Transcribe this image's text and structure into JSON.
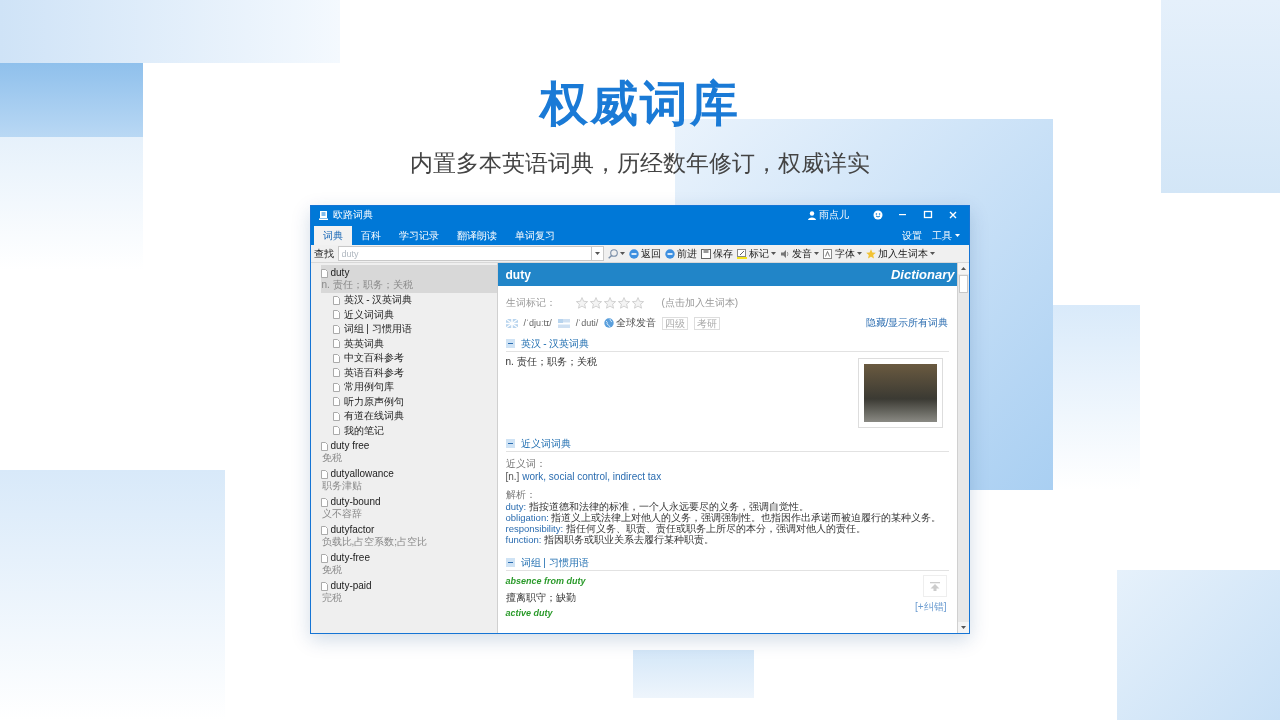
{
  "page": {
    "title": "权威词库",
    "subtitle": "内置多本英语词典，历经数年修订，权威详实"
  },
  "app": {
    "title": "欧路词典",
    "user": "雨点儿",
    "tabs": [
      {
        "label": "词典",
        "selected": true
      },
      {
        "label": "百科",
        "selected": false
      },
      {
        "label": "学习记录",
        "selected": false
      },
      {
        "label": "翻译朗读",
        "selected": false
      },
      {
        "label": "单词复习",
        "selected": false
      }
    ],
    "menu": [
      {
        "label": "设置",
        "dropdown": false
      },
      {
        "label": "工具",
        "dropdown": true
      }
    ],
    "search": {
      "label": "查找",
      "value": "duty"
    },
    "toolbar": [
      {
        "kind": "back",
        "label": "返回",
        "dropdown": false
      },
      {
        "kind": "forward",
        "label": "前进",
        "dropdown": false
      },
      {
        "kind": "save",
        "label": "保存",
        "dropdown": false
      },
      {
        "kind": "mark",
        "label": "标记",
        "dropdown": true
      },
      {
        "kind": "speak",
        "label": "发音",
        "dropdown": true
      },
      {
        "kind": "font",
        "label": "字体",
        "dropdown": true
      },
      {
        "kind": "star",
        "label": "加入生词本",
        "dropdown": true
      }
    ],
    "sidebar": [
      {
        "word": "duty",
        "meaning": "n. 责任；职务；关税",
        "selected": true,
        "children": [
          {
            "label": "英汉 - 汉英词典"
          },
          {
            "label": "近义词词典"
          },
          {
            "label": "词组 | 习惯用语"
          },
          {
            "label": "英英词典"
          },
          {
            "label": "中文百科参考"
          },
          {
            "label": "英语百科参考"
          },
          {
            "label": "常用例句库"
          },
          {
            "label": "听力原声例句"
          },
          {
            "label": "有道在线词典"
          },
          {
            "label": "我的笔记"
          }
        ]
      },
      {
        "word": "duty free",
        "meaning": "免税",
        "selected": false
      },
      {
        "word": "dutyallowance",
        "meaning": "职务津贴",
        "selected": false
      },
      {
        "word": "duty-bound",
        "meaning": "义不容辞",
        "selected": false
      },
      {
        "word": "dutyfactor",
        "meaning": "负载比,占空系数;占空比",
        "selected": false
      },
      {
        "word": "duty-free",
        "meaning": "免税",
        "selected": false
      },
      {
        "word": "duty-paid",
        "meaning": "完税",
        "selected": false
      }
    ],
    "entry": {
      "word": "duty",
      "brand": "Dictionary",
      "stars_label": "生词标记：",
      "stars": 0,
      "stars_hint": "(点击加入生词本)",
      "pron": [
        {
          "kind": "uk",
          "text": "/ˈdjuːtɪ/"
        },
        {
          "kind": "us",
          "text": "/ˈduti/"
        }
      ],
      "global_pron": "全球发音",
      "tags": [
        "四级",
        "考研"
      ],
      "toggle_all": "隐藏/显示所有词典",
      "sections": [
        {
          "kind": "definition",
          "title": "英汉 - 汉英词典",
          "expanded": true,
          "text": "n. 责任；职务；关税"
        },
        {
          "kind": "synonyms",
          "title": "近义词词典",
          "expanded": true,
          "syn_label": "近义词：",
          "pos": "[n.]",
          "words": "work, social control, indirect tax",
          "analysis_label": "解析：",
          "lines": [
            {
              "term": "duty:",
              "text": "指按道德和法律的标准，一个人永远要尽的义务，强调自觉性。"
            },
            {
              "term": "obligation:",
              "text": "指道义上或法律上对他人的义务，强调强制性。也指因作出承诺而被迫履行的某种义务。"
            },
            {
              "term": "responsibility:",
              "text": "指任何义务、职责、责任或职务上所尽的本分，强调对他人的责任。"
            },
            {
              "term": "function:",
              "text": "指因职务或职业关系去履行某种职责。"
            }
          ]
        },
        {
          "kind": "phrases",
          "title": "词组 | 习惯用语",
          "expanded": true,
          "report": "[+纠错]",
          "items": [
            {
              "phrase": "absence from duty",
              "meaning": "擅离职守；缺勤"
            },
            {
              "phrase": "active duty"
            }
          ]
        }
      ]
    }
  }
}
